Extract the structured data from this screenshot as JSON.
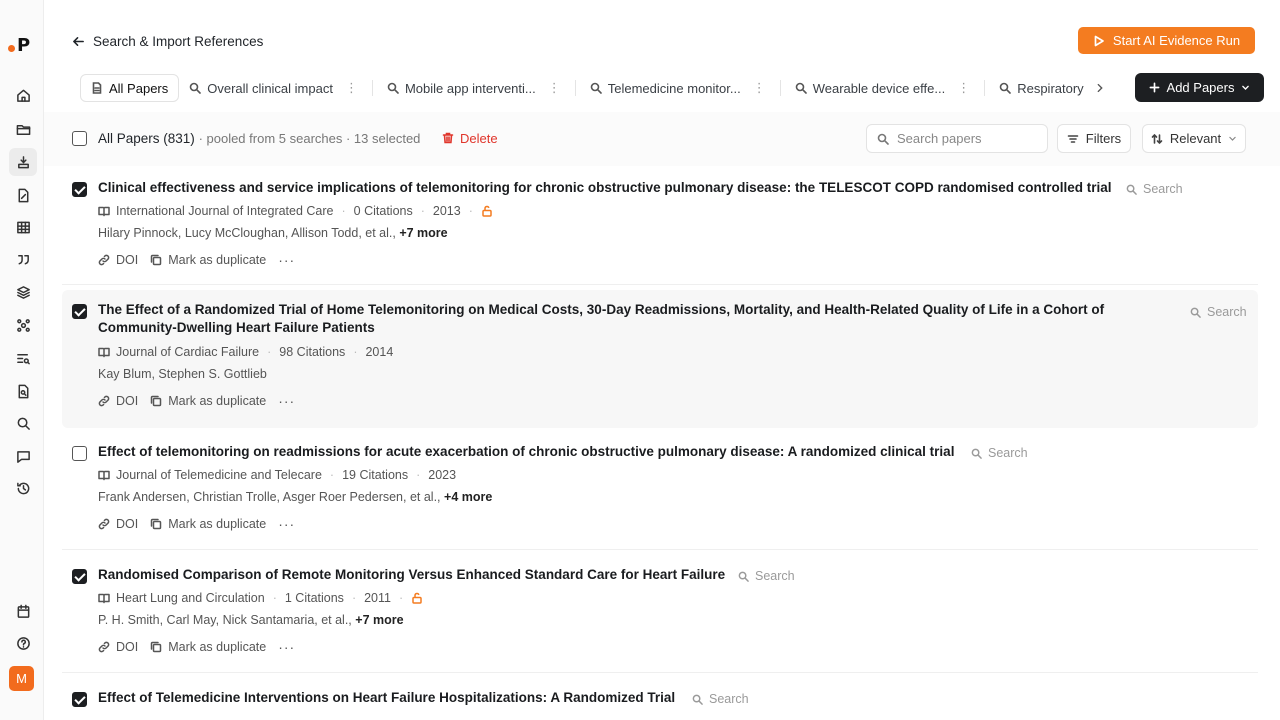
{
  "header": {
    "back_label": "Search & Import References",
    "start_button": "Start AI Evidence Run",
    "avatar_initial": "M"
  },
  "tabs": [
    {
      "label": "All Papers"
    },
    {
      "label": "Overall clinical impact"
    },
    {
      "label": "Mobile app interventi..."
    },
    {
      "label": "Telemedicine monitor..."
    },
    {
      "label": "Wearable device effe..."
    },
    {
      "label": "Respiratory"
    }
  ],
  "add_papers_label": "Add Papers",
  "toolbar": {
    "all_papers": "All Papers (831)",
    "pooled": "· pooled from 5 searches · 13 selected",
    "delete_label": "Delete",
    "search_placeholder": "Search papers",
    "filters_label": "Filters",
    "sort_label": "Relevant"
  },
  "paper_actions": {
    "search": "Search",
    "doi": "DOI",
    "duplicate": "Mark as duplicate",
    "more": "···"
  },
  "papers": [
    {
      "title": "Clinical effectiveness and service implications of telemonitoring for chronic obstructive pulmonary disease: the TELESCOT COPD randomised controlled trial",
      "journal": "International Journal of Integrated Care",
      "citations": "0 Citations",
      "year": "2013",
      "authors": "Hilary Pinnock, Lucy McCloughan, Allison Todd, et al.,",
      "more_authors": "+7 more"
    },
    {
      "title": "The Effect of a Randomized Trial of Home Telemonitoring on Medical Costs, 30-Day Readmissions, Mortality, and Health-Related Quality of Life in a Cohort of Community-Dwelling Heart Failure Patients",
      "journal": "Journal of Cardiac Failure",
      "citations": "98 Citations",
      "year": "2014",
      "authors": "Kay Blum, Stephen S. Gottlieb",
      "more_authors": ""
    },
    {
      "title": "Effect of telemonitoring on readmissions for acute exacerbation of chronic obstructive pulmonary disease: A randomized clinical trial",
      "journal": "Journal of Telemedicine and Telecare",
      "citations": "19 Citations",
      "year": "2023",
      "authors": "Frank Andersen, Christian Trolle, Asger Roer Pedersen, et al.,",
      "more_authors": "+4 more"
    },
    {
      "title": "Randomised Comparison of Remote Monitoring Versus Enhanced Standard Care for Heart Failure",
      "journal": "Heart Lung and Circulation",
      "citations": "1 Citations",
      "year": "2011",
      "authors": "P. H. Smith, Carl May, Nick Santamaria, et al.,",
      "more_authors": "+7 more"
    },
    {
      "title": "Effect of Telemedicine Interventions on Heart Failure Hospitalizations: A Randomized Trial"
    }
  ],
  "colors": {
    "accent": "#f47c20",
    "danger": "#e0352b",
    "dark_button": "#1d1f22"
  }
}
